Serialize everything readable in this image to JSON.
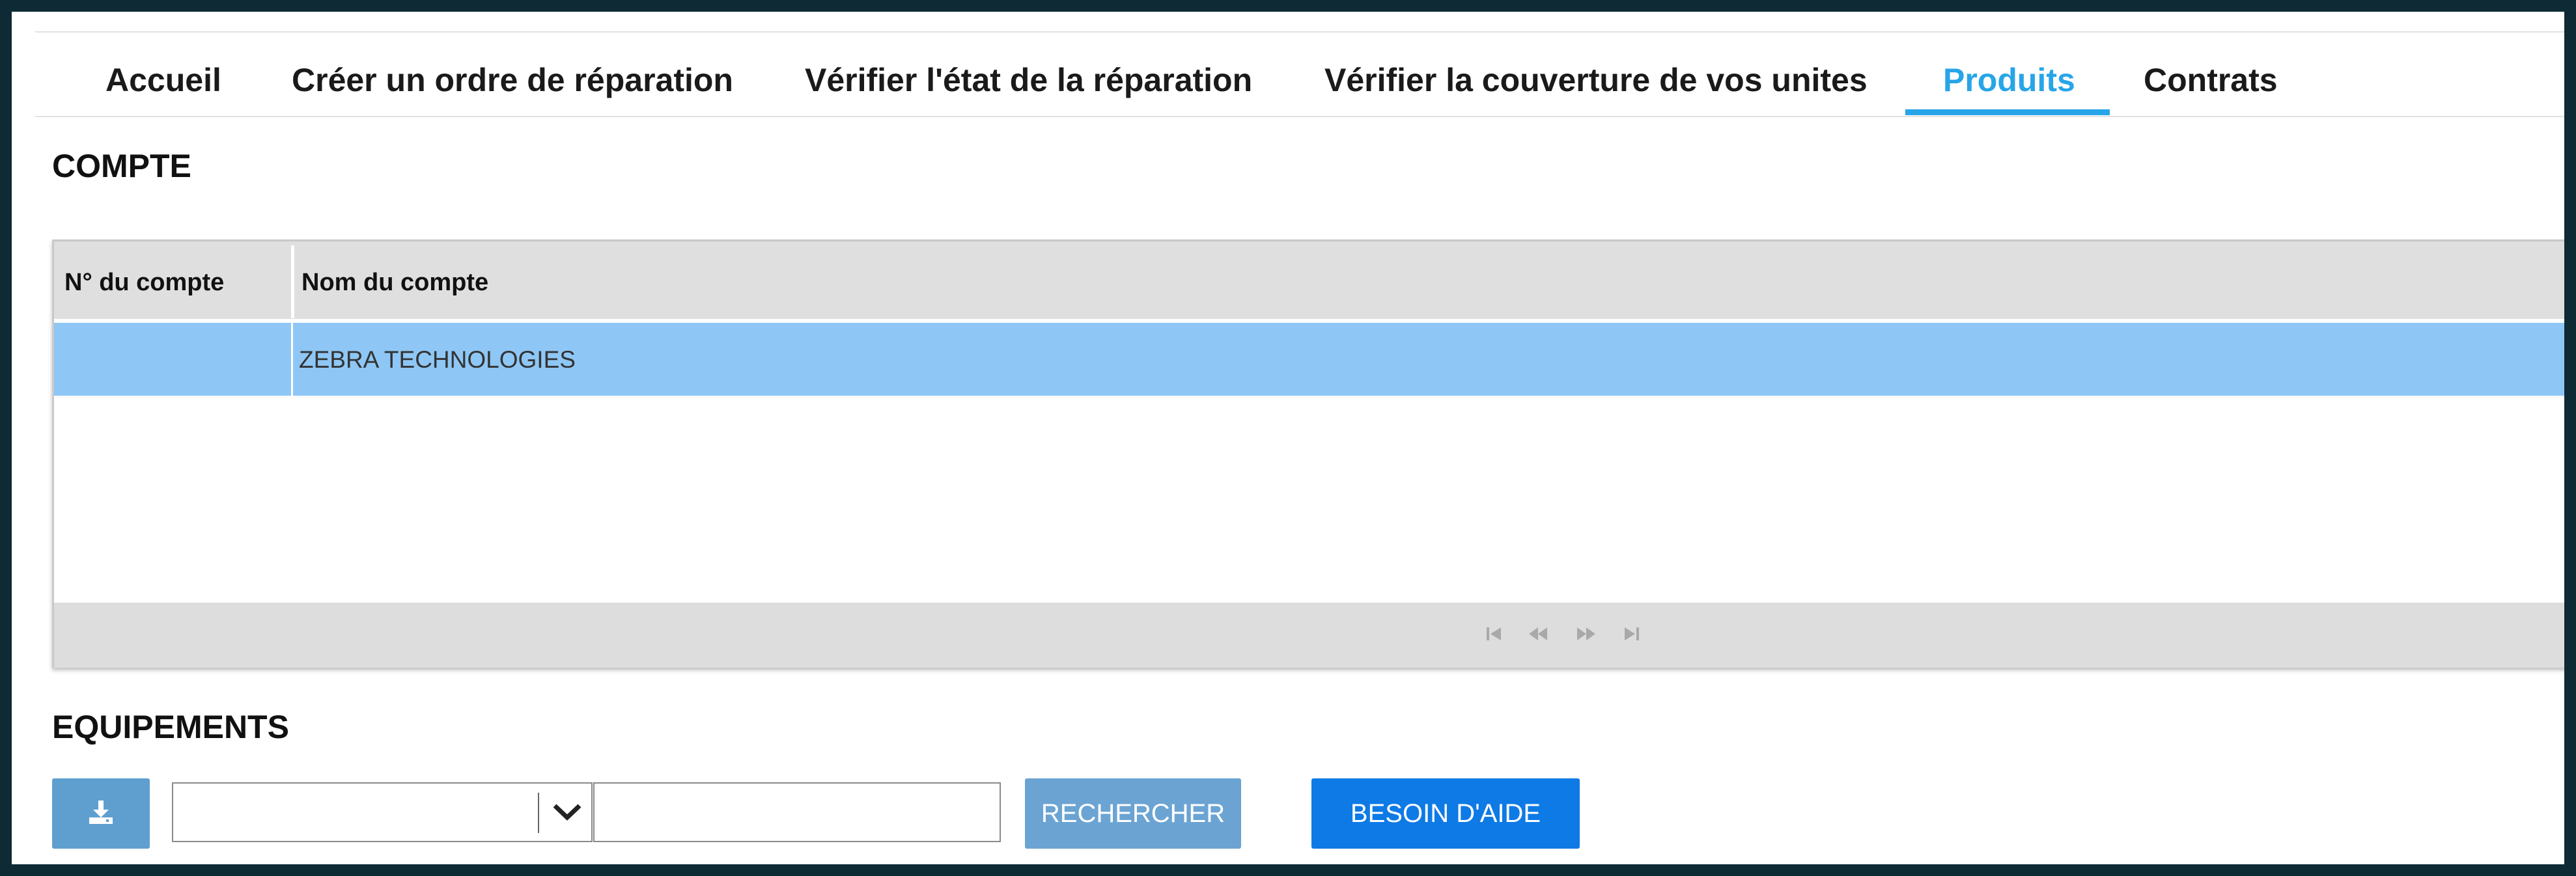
{
  "nav": {
    "tabs": [
      {
        "label": "Accueil",
        "active": false
      },
      {
        "label": "Créer un ordre de réparation",
        "active": false
      },
      {
        "label": "Vérifier l'état de la réparation",
        "active": false
      },
      {
        "label": "Vérifier la couverture de vos unites",
        "active": false
      },
      {
        "label": "Produits",
        "active": true
      },
      {
        "label": "Contrats",
        "active": false
      }
    ]
  },
  "account": {
    "title": "COMPTE",
    "columns": [
      "N° du compte",
      "Nom du compte"
    ],
    "rows": [
      {
        "number": "",
        "name": "ZEBRA TECHNOLOGIES",
        "selected": true
      }
    ],
    "pager": {
      "icons": [
        "first-page-icon",
        "previous-page-icon",
        "next-page-icon",
        "last-page-icon"
      ]
    }
  },
  "equipment": {
    "title": "EQUIPEMENTS",
    "download_icon": "download-icon",
    "filter_select": {
      "value": ""
    },
    "search_input": {
      "value": "",
      "placeholder": ""
    },
    "search_label": "RECHERCHER",
    "help_label": "BESOIN D'AIDE"
  },
  "colors": {
    "accent": "#27a5e8",
    "selected_row": "#8ec7f6",
    "search_button": "#6ba4d3",
    "help_button": "#0e7ae6",
    "frame": "#0e2a35"
  }
}
